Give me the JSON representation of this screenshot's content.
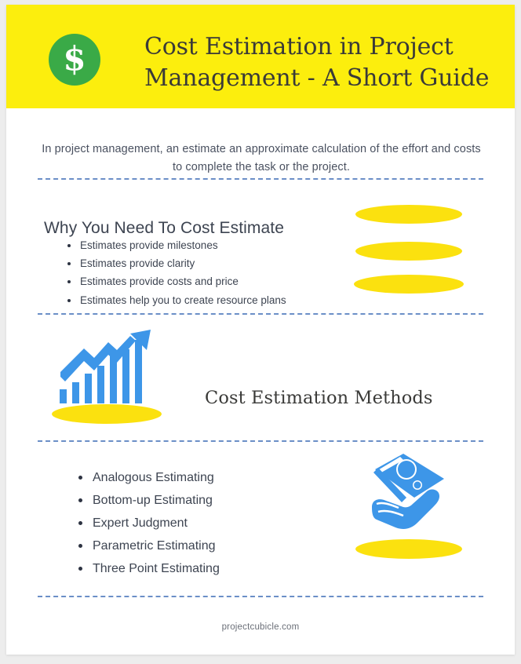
{
  "colors": {
    "header_bg": "#fcee0d",
    "badge_green": "#3aaa47",
    "accent_blue": "#3d96e8",
    "ellipse_yellow": "#fbe10f",
    "divider_blue": "#6b8fc7",
    "text_dark": "#3d4451",
    "title_dark": "#3a3a38",
    "page_bg": "#ededed"
  },
  "header": {
    "badge_glyph": "$",
    "badge_icon_name": "dollar-sign-icon",
    "title": "Cost Estimation in Project Management - A Short Guide"
  },
  "intro": {
    "text": "In project management, an estimate an approximate calculation of the effort and costs to complete the task or the project."
  },
  "why_section": {
    "heading": "Why You Need To Cost Estimate",
    "items": [
      "Estimates provide milestones",
      "Estimates provide clarity",
      "Estimates provide costs and price",
      "Estimates help you to create resource plans"
    ]
  },
  "methods_section": {
    "heading": "Cost Estimation Methods",
    "chart_icon_name": "growth-bar-chart-icon",
    "hand_icon_name": "hand-holding-money-icon",
    "items": [
      "Analogous Estimating",
      "Bottom-up Estimating",
      "Expert Judgment",
      "Parametric Estimating",
      "Three Point Estimating"
    ]
  },
  "footer": {
    "source": "projectcubicle.com"
  }
}
